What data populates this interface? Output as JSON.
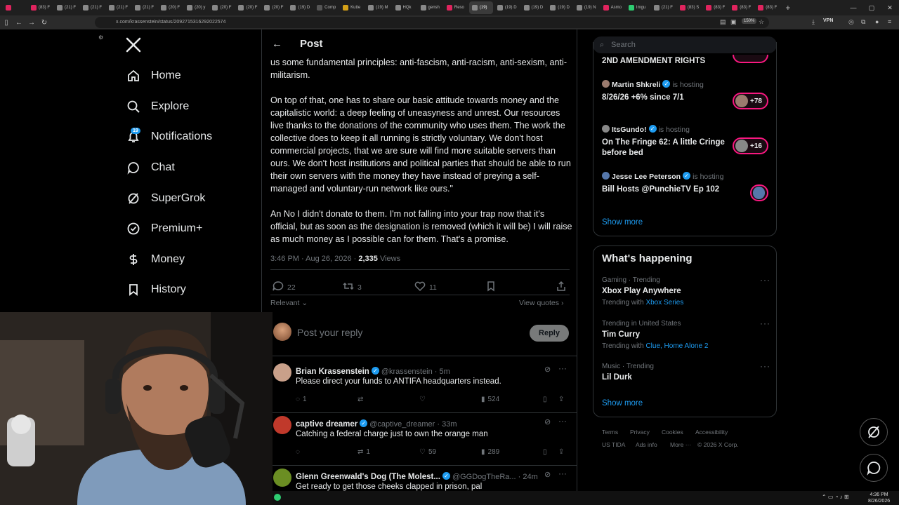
{
  "browser": {
    "tabs": [
      {
        "label": "",
        "color": "#e0245e"
      },
      {
        "label": "(83) F",
        "color": "#e0245e"
      },
      {
        "label": "(21) F",
        "color": "#888"
      },
      {
        "label": "(21) F",
        "color": "#888"
      },
      {
        "label": "(21) F",
        "color": "#888"
      },
      {
        "label": "(21) F",
        "color": "#888"
      },
      {
        "label": "(20) F",
        "color": "#888"
      },
      {
        "label": "(20) y",
        "color": "#888"
      },
      {
        "label": "(20) F",
        "color": "#888"
      },
      {
        "label": "(20) F",
        "color": "#888"
      },
      {
        "label": "(20) F",
        "color": "#888"
      },
      {
        "label": "(19) D",
        "color": "#888"
      },
      {
        "label": "Comp",
        "color": "#555"
      },
      {
        "label": "Kutte",
        "color": "#d4a017"
      },
      {
        "label": "(19) M",
        "color": "#888"
      },
      {
        "label": "HQk",
        "color": "#888"
      },
      {
        "label": "gensh",
        "color": "#888"
      },
      {
        "label": "Reso",
        "color": "#e0245e"
      },
      {
        "label": "(19)",
        "color": "#888"
      },
      {
        "label": "(19) D",
        "color": "#888"
      },
      {
        "label": "(19) D",
        "color": "#888"
      },
      {
        "label": "(19) D",
        "color": "#888"
      },
      {
        "label": "(19) N",
        "color": "#888"
      },
      {
        "label": "Asmo",
        "color": "#e0245e"
      },
      {
        "label": "Imgu",
        "color": "#2ecc71"
      },
      {
        "label": "(21) F",
        "color": "#888"
      },
      {
        "label": "(83) S",
        "color": "#e0245e"
      },
      {
        "label": "(83) F",
        "color": "#e0245e"
      },
      {
        "label": "(83) F",
        "color": "#e0245e"
      },
      {
        "label": "(83) F",
        "color": "#e0245e"
      }
    ],
    "active_tab_index": 18,
    "url": "x.com/krassenstein/status/2092715316292022574",
    "zoom": "150%",
    "vpn": "VPN"
  },
  "nav": {
    "logo": "X",
    "items": [
      {
        "label": "Home",
        "icon": "home-icon"
      },
      {
        "label": "Explore",
        "icon": "search-icon"
      },
      {
        "label": "Notifications",
        "icon": "bell-icon"
      },
      {
        "label": "Chat",
        "icon": "chat-icon"
      },
      {
        "label": "SuperGrok",
        "icon": "grok-icon"
      },
      {
        "label": "Premium+",
        "icon": "premium-icon"
      },
      {
        "label": "Money",
        "icon": "money-icon"
      },
      {
        "label": "History",
        "icon": "bookmark-icon"
      }
    ],
    "notif_badge": "19"
  },
  "post": {
    "header_title": "Post",
    "paragraphs": [
      "us some fundamental principles: anti-fascism, anti-racism, anti-sexism, anti-militarism.",
      "On top of that, one has to share our basic attitude towards money and the capitalistic world: a deep feeling of uneasyness and unrest.  Our resources live thanks to the donations of the community who uses them. The work the collective does to keep it all running is strictly voluntary. We don't host commercial projects, that we are sure will find more suitable servers than ours. We don't host institutions and political parties that should be able to run their own servers with the money they have instead of preying a self-managed and voluntary-run network like ours.\"",
      "An No I didn't donate to them.  I'm not falling into your trap now that it's official, but as soon as the designation is removed (which it will be) I will raise as much money as I possible can for them.  That's a promise."
    ],
    "timestamp": "3:46 PM · Aug 26, 2026 · ",
    "views_count": "2,335",
    "views_label": " Views",
    "stats": {
      "replies": "22",
      "reposts": "3",
      "likes": "11"
    },
    "relevant_label": "Relevant",
    "view_quotes_label": "View quotes",
    "reply_placeholder": "Post your reply",
    "reply_button": "Reply"
  },
  "replies": [
    {
      "name": "Brian Krassenstein",
      "handle": "@krassenstein · 5m",
      "text": "Please direct your funds to ANTIFA headquarters instead.",
      "replies": "1",
      "reposts": "",
      "likes": "",
      "views": "524",
      "avatar_color": "#c9a08a"
    },
    {
      "name": "captive dreamer",
      "handle": "@captive_dreamer · 33m",
      "text": "Catching a federal charge just to own the orange man",
      "replies": "",
      "reposts": "1",
      "likes": "59",
      "views": "289",
      "avatar_color": "#c0392b"
    },
    {
      "name": "Glenn Greenwald's Dog (The Molest...",
      "handle": "@GGDogTheRa... · 24m",
      "text": "Get ready to get those cheeks clapped in prison, pal",
      "replies": "",
      "reposts": "",
      "likes": "",
      "views": "",
      "avatar_color": "#6b8e23"
    }
  ],
  "right": {
    "search_placeholder": "Search",
    "spaces_top_title": "2ND AMENDMENT RIGHTS",
    "spaces": [
      {
        "host": "Martin Shkreli",
        "is_hosting": "is hosting",
        "title": "8/26/26 +6% since 7/1",
        "count": "+78"
      },
      {
        "host": "ItsGundo!",
        "is_hosting": "is hosting",
        "title": "On The Fringe 62:  A little Cringe before bed",
        "count": "+16"
      },
      {
        "host": "Jesse Lee Peterson",
        "is_hosting": "is hosting",
        "title": "Bill Hosts @PunchieTV Ep 102",
        "count": ""
      }
    ],
    "show_more_1": "Show more",
    "happening_title": "What's happening",
    "trends": [
      {
        "category": "Gaming · Trending",
        "title": "Xbox Play Anywhere",
        "with_label": "Trending with ",
        "with_links": "Xbox Series"
      },
      {
        "category": "Trending in United States",
        "title": "Tim Curry",
        "with_label": "Trending with ",
        "with_links": "Clue, Home Alone 2"
      },
      {
        "category": "Music · Trending",
        "title": "Lil Durk",
        "with_label": "",
        "with_links": ""
      }
    ],
    "show_more_2": "Show more",
    "footer": [
      "Terms",
      "Privacy",
      "Cookies",
      "Accessibility",
      "US TIDA",
      "Ads info",
      "More ···",
      "© 2026 X Corp."
    ]
  },
  "taskbar": {
    "time": "4:36 PM",
    "date": "8/26/2026"
  },
  "colors": {
    "accent": "#1d9bf0",
    "space_pink": "#f91880",
    "bg": "#000000",
    "border": "#2f3336",
    "muted": "#71767b"
  }
}
